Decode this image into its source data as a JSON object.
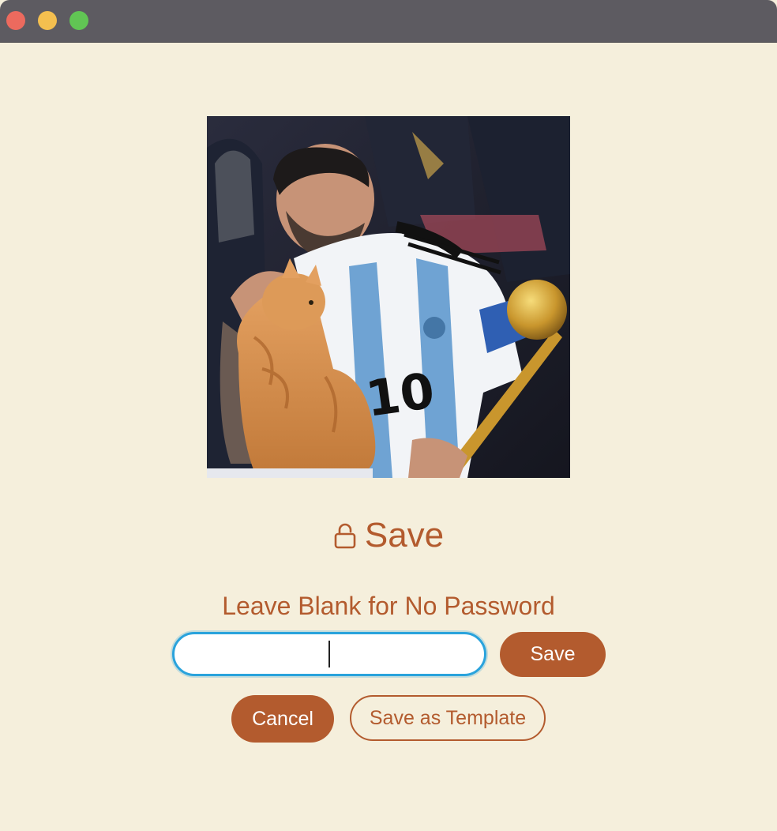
{
  "window": {
    "controls": [
      "close",
      "minimize",
      "maximize"
    ]
  },
  "photo": {
    "jersey_number": "10"
  },
  "header": {
    "icon": "lock-icon",
    "title": "Save"
  },
  "form": {
    "hint": "Leave Blank for No Password",
    "password_value": "",
    "save_label": "Save",
    "cancel_label": "Cancel",
    "template_label": "Save as Template"
  },
  "colors": {
    "accent": "#b35b2e",
    "background": "#f5efdc",
    "focus_ring": "#2aa3dc"
  }
}
